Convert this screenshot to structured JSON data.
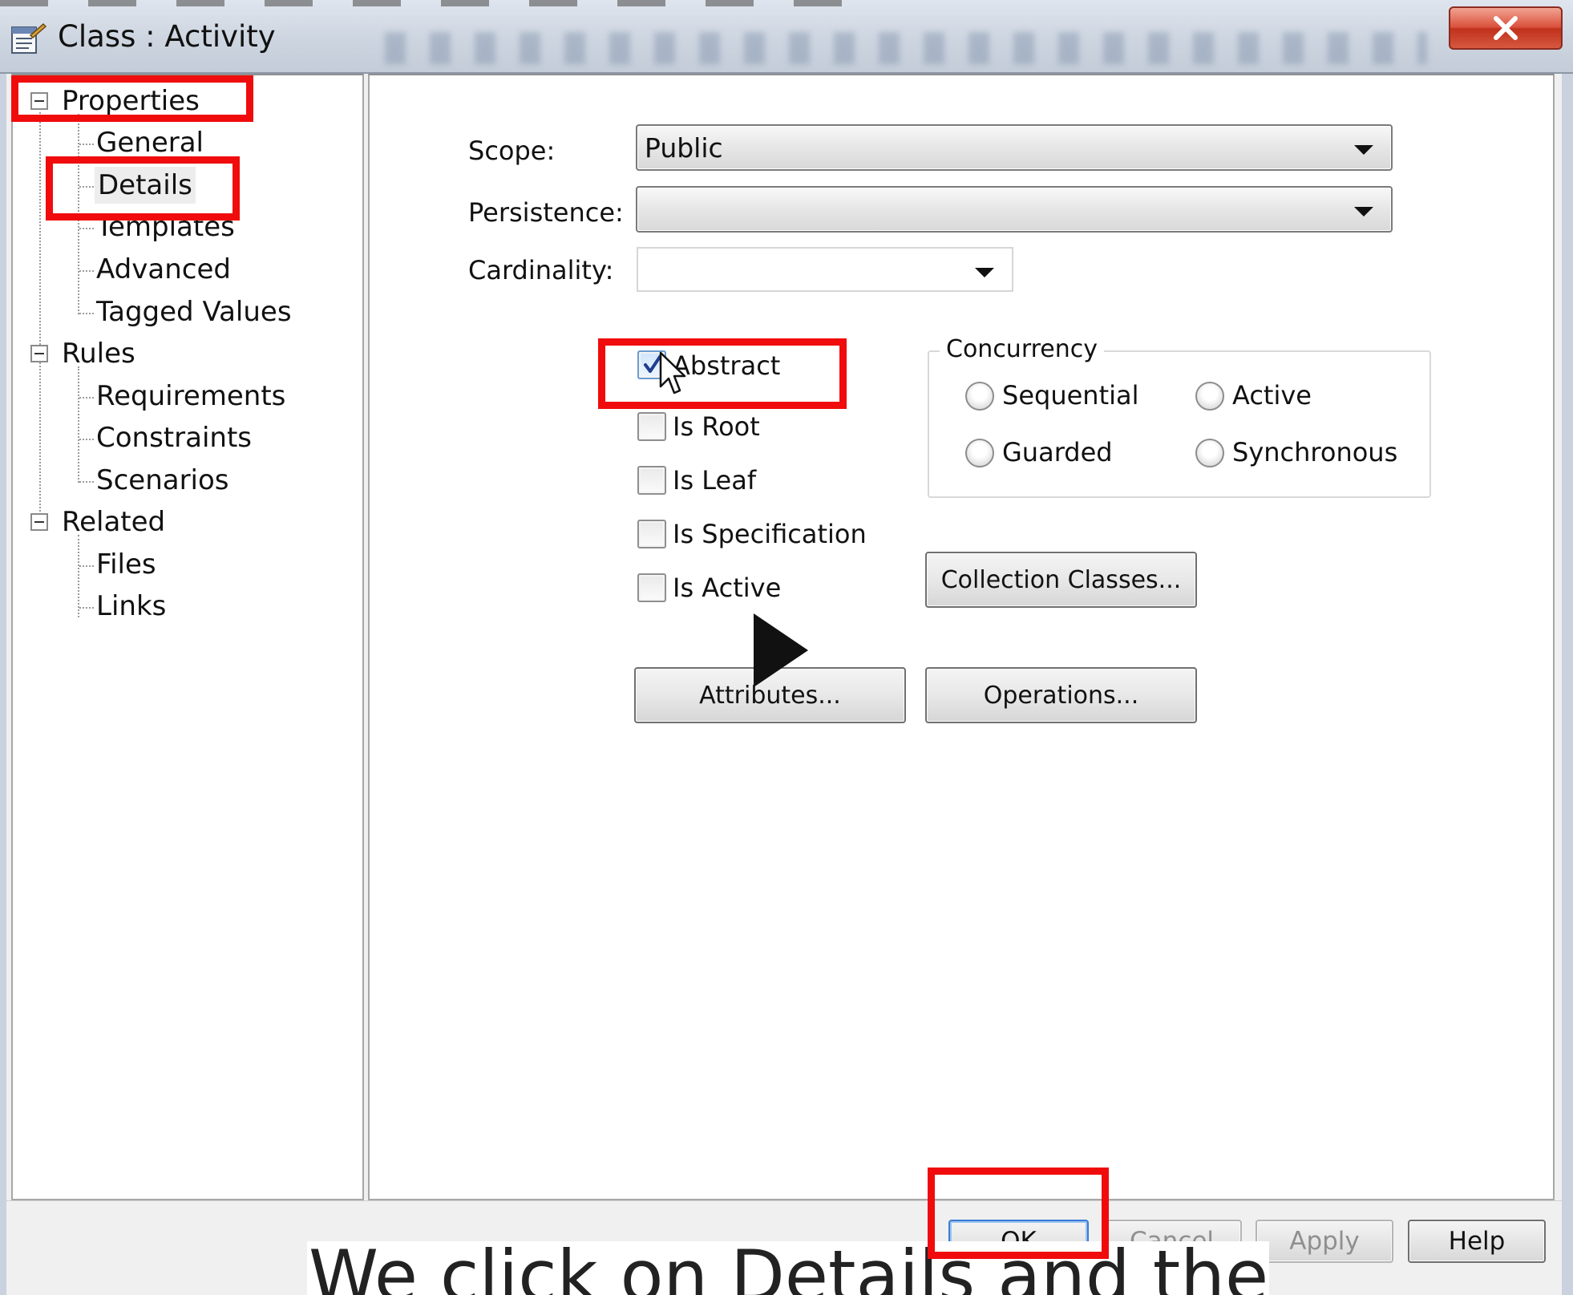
{
  "window": {
    "title": "Class : Activity"
  },
  "tree": {
    "groups": [
      {
        "label": "Properties",
        "children": [
          "General",
          "Details",
          "Templates",
          "Advanced",
          "Tagged Values"
        ]
      },
      {
        "label": "Rules",
        "children": [
          "Requirements",
          "Constraints",
          "Scenarios"
        ]
      },
      {
        "label": "Related",
        "children": [
          "Files",
          "Links"
        ]
      }
    ],
    "selected": "Details"
  },
  "details": {
    "scope_label": "Scope:",
    "scope_value": "Public",
    "persistence_label": "Persistence:",
    "persistence_value": "",
    "cardinality_label": "Cardinality:",
    "cardinality_value": "",
    "checkboxes": [
      {
        "label": "Abstract",
        "checked": true
      },
      {
        "label": "Is Root",
        "checked": false
      },
      {
        "label": "Is Leaf",
        "checked": false
      },
      {
        "label": "Is Specification",
        "checked": false
      },
      {
        "label": "Is Active",
        "checked": false
      }
    ],
    "concurrency": {
      "title": "Concurrency",
      "options": [
        "Sequential",
        "Active",
        "Guarded",
        "Synchronous"
      ],
      "selected": null
    },
    "buttons": {
      "collection_classes": "Collection Classes...",
      "attributes": "Attributes...",
      "operations": "Operations..."
    }
  },
  "dialog_buttons": {
    "ok": "OK",
    "cancel": "Cancel",
    "apply": "Apply",
    "help": "Help"
  },
  "caption": "We click on Details and then",
  "colors": {
    "highlight": "#f00c0c",
    "close_button": "#d9503c",
    "default_button_border": "#3b7bd3"
  },
  "icons": {
    "app": "class-properties-icon",
    "close": "close-icon",
    "play": "play-icon",
    "cursor": "mouse-cursor-icon"
  }
}
